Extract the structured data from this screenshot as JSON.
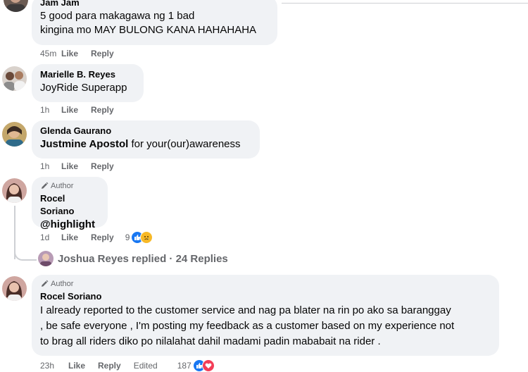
{
  "comments": [
    {
      "name": "Jam Jam",
      "lines": [
        "5 good para makagawa ng 1 bad",
        "kingina mo MAY BULONG KANA HAHAHAHA"
      ],
      "time": "45m",
      "like": "Like",
      "reply": "Reply"
    },
    {
      "name": "Marielle B. Reyes",
      "text": "JoyRide Superapp",
      "time": "1h",
      "like": "Like",
      "reply": "Reply"
    },
    {
      "name": "Glenda Gaurano",
      "tag": "Justmine Apostol",
      "text": " for your(our)awareness",
      "time": "1h",
      "like": "Like",
      "reply": "Reply"
    },
    {
      "badge": "Author",
      "name": "Rocel Soriano",
      "text": "@highlight",
      "time": "1d",
      "like": "Like",
      "reply": "Reply",
      "reaction_count": "9"
    },
    {
      "badge": "Author",
      "name": "Rocel Soriano",
      "lines": [
        "I already reported to the customer service and nag pa blater na rin po ako sa baranggay",
        ", be safe everyone , I'm posting my feedback as a customer based on my experience not",
        "to brag all riders diko po nilalahat dahil madami padin mababait na rider ."
      ],
      "time": "23h",
      "like": "Like",
      "reply": "Reply",
      "edited": "Edited",
      "reaction_count": "187"
    }
  ],
  "replies_link": "Joshua Reyes replied · 24 Replies",
  "colors": {
    "bubble": "#f0f2f5",
    "meta": "#65676b",
    "like_blue": "#1877f2",
    "love_red": "#f33e58",
    "sad_yellow": "#f7b928"
  },
  "icons": [
    "user-avatar",
    "pencil-icon",
    "like-reaction-icon",
    "sad-reaction-icon",
    "love-reaction-icon"
  ]
}
